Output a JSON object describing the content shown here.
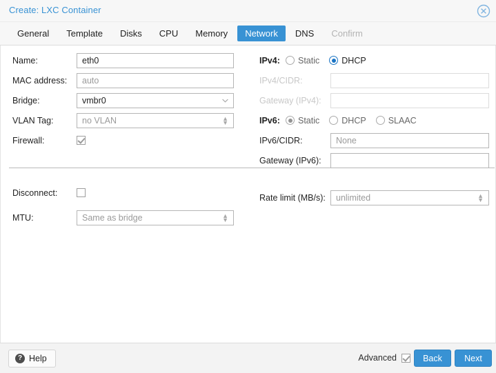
{
  "window": {
    "title": "Create: LXC Container",
    "close_icon": "close-circle-icon"
  },
  "tabs": [
    {
      "label": "General",
      "state": "normal"
    },
    {
      "label": "Template",
      "state": "normal"
    },
    {
      "label": "Disks",
      "state": "normal"
    },
    {
      "label": "CPU",
      "state": "normal"
    },
    {
      "label": "Memory",
      "state": "normal"
    },
    {
      "label": "Network",
      "state": "active"
    },
    {
      "label": "DNS",
      "state": "normal"
    },
    {
      "label": "Confirm",
      "state": "disabled"
    }
  ],
  "form": {
    "left": {
      "name_label": "Name:",
      "name_value": "eth0",
      "mac_label": "MAC address:",
      "mac_placeholder": "auto",
      "bridge_label": "Bridge:",
      "bridge_value": "vmbr0",
      "vlan_label": "VLAN Tag:",
      "vlan_placeholder": "no VLAN",
      "firewall_label": "Firewall:",
      "firewall_checked": true,
      "disconnect_label": "Disconnect:",
      "disconnect_checked": false,
      "mtu_label": "MTU:",
      "mtu_placeholder": "Same as bridge"
    },
    "right": {
      "ipv4_label": "IPv4:",
      "ipv4_options": [
        "Static",
        "DHCP"
      ],
      "ipv4_selected": "DHCP",
      "ipv4_cidr_label": "IPv4/CIDR:",
      "ipv4_cidr_value": "",
      "ipv4_gateway_label": "Gateway (IPv4):",
      "ipv4_gateway_value": "",
      "ipv6_label": "IPv6:",
      "ipv6_options": [
        "Static",
        "DHCP",
        "SLAAC"
      ],
      "ipv6_selected": "Static",
      "ipv6_cidr_label": "IPv6/CIDR:",
      "ipv6_cidr_placeholder": "None",
      "ipv6_gateway_label": "Gateway (IPv6):",
      "ipv6_gateway_value": "",
      "rate_limit_label": "Rate limit (MB/s):",
      "rate_limit_placeholder": "unlimited"
    }
  },
  "footer": {
    "help_label": "Help",
    "help_icon": "question-mark-icon",
    "advanced_label": "Advanced",
    "advanced_checked": true,
    "back_label": "Back",
    "next_label": "Next"
  },
  "colors": {
    "accent": "#3892d4",
    "title_text": "#3892d4",
    "radio_selected": "#1a74c4",
    "disabled_text": "#c8c8c8",
    "placeholder_text": "#9a9a9a"
  }
}
